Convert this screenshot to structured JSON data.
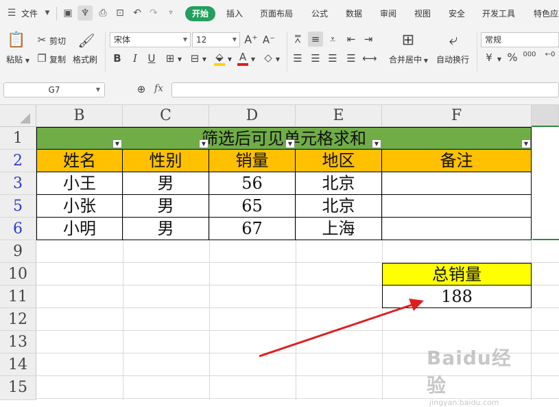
{
  "menubar": {
    "file_label": "文件",
    "tabs": [
      "开始",
      "插入",
      "页面布局",
      "公式",
      "数据",
      "审阅",
      "视图",
      "安全",
      "开发工具",
      "特色应"
    ]
  },
  "ribbon": {
    "paste": "粘贴",
    "cut": "剪切",
    "copy": "复制",
    "format_painter": "格式刷",
    "font_name": "宋体",
    "font_size": "12",
    "merge_center": "合并居中",
    "wrap_text": "自动换行",
    "number_format": "常规",
    "percent": "%",
    "thousands": "000"
  },
  "formula_bar": {
    "name_box": "G7",
    "fx": "fx",
    "formula": ""
  },
  "columns": [
    "B",
    "C",
    "D",
    "E",
    "F"
  ],
  "rows": [
    "1",
    "2",
    "3",
    "5",
    "6",
    "9",
    "10",
    "11",
    "12",
    "13",
    "14",
    "15"
  ],
  "table": {
    "title": "筛选后可见单元格求和",
    "headers": [
      "姓名",
      "性别",
      "销量",
      "地区",
      "备注"
    ],
    "rows": [
      [
        "小王",
        "男",
        "56",
        "北京",
        ""
      ],
      [
        "小张",
        "男",
        "65",
        "北京",
        ""
      ],
      [
        "小明",
        "男",
        "67",
        "上海",
        ""
      ]
    ]
  },
  "summary": {
    "label": "总销量",
    "value": "188"
  },
  "colors": {
    "title_fill": "#70ad47",
    "header_fill": "#ffc000",
    "summary_fill": "#ffff00",
    "arrow": "#e01e1e",
    "accent": "#23a05e"
  },
  "watermark": {
    "brand": "Baidu经验",
    "url": "jingyan.baidu.com"
  }
}
